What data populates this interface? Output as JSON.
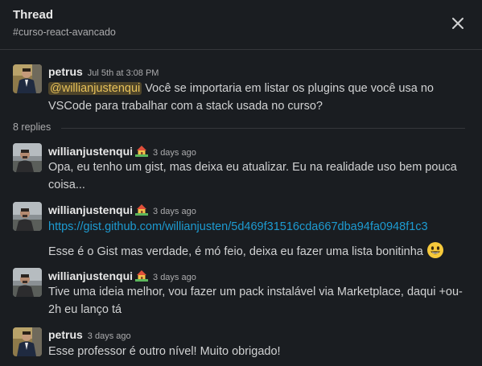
{
  "header": {
    "title": "Thread",
    "channel": "#curso-react-avancado",
    "close_icon": "close-icon"
  },
  "messages": [
    {
      "author": "petrus",
      "time": "Jul 5th at 3:08 PM",
      "mention": "@willianjustenqui",
      "text_line1": " Você se importaria em listar os plugins que você usa no",
      "text_line2": "VSCode para trabalhar com a stack usada no curso?"
    },
    {
      "author": "willianjustenqui",
      "time": "3 days ago",
      "status_icon": "house-with-garden-icon",
      "text_line1": "Opa, eu tenho um gist, mas deixa eu atualizar. Eu na realidade uso bem pouca",
      "text_line2": "coisa..."
    },
    {
      "author": "willianjustenqui",
      "time": "3 days ago",
      "status_icon": "house-with-garden-icon",
      "link": "https://gist.github.com/willianjusten/5d469f31516cda667dba94fa0948f1c3",
      "text": "Esse é o Gist mas verdade, é mó feio, deixa eu fazer uma lista bonitinha",
      "emoji_icon": "smiley-icon"
    },
    {
      "author": "willianjustenqui",
      "time": "3 days ago",
      "status_icon": "house-with-garden-icon",
      "text_line1": "Tive uma ideia melhor, vou fazer um pack instalável via Marketplace, daqui +ou-",
      "text_line2": "2h eu lanço tá"
    },
    {
      "author": "petrus",
      "time": "3 days ago",
      "text": "Esse professor é outro nível! Muito obrigado!"
    }
  ],
  "replies_label": "8 replies",
  "colors": {
    "background": "#1a1d21",
    "text": "#d1d2d3",
    "muted": "#ababad",
    "link": "#1d9bd1",
    "mention_bg": "#4e4429",
    "mention_text": "#e8c25a"
  }
}
